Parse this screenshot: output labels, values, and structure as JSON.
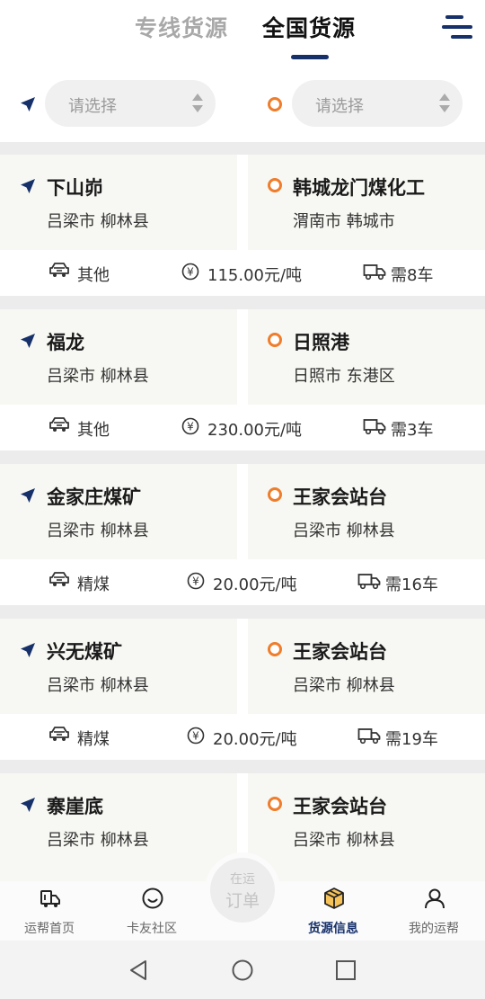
{
  "header": {
    "tabs": [
      {
        "label": "专线货源",
        "active": false
      },
      {
        "label": "全国货源",
        "active": true
      }
    ],
    "accent_color": "#16306a"
  },
  "filters": {
    "origin_placeholder": "请选择",
    "destination_placeholder": "请选择"
  },
  "cards": [
    {
      "origin_name": "下山峁",
      "origin_area": "吕梁市 柳林县",
      "dest_name": "韩城龙门煤化工",
      "dest_area": "渭南市 韩城市",
      "cargo": "其他",
      "price": "115.00元/吨",
      "trucks": "需8车"
    },
    {
      "origin_name": "福龙",
      "origin_area": "吕梁市 柳林县",
      "dest_name": "日照港",
      "dest_area": "日照市 东港区",
      "cargo": "其他",
      "price": "230.00元/吨",
      "trucks": "需3车"
    },
    {
      "origin_name": "金家庄煤矿",
      "origin_area": "吕梁市 柳林县",
      "dest_name": "王家会站台",
      "dest_area": "吕梁市 柳林县",
      "cargo": "精煤",
      "price": "20.00元/吨",
      "trucks": "需16车"
    },
    {
      "origin_name": "兴无煤矿",
      "origin_area": "吕梁市 柳林县",
      "dest_name": "王家会站台",
      "dest_area": "吕梁市 柳林县",
      "cargo": "精煤",
      "price": "20.00元/吨",
      "trucks": "需19车"
    },
    {
      "origin_name": "寨崖底",
      "origin_area": "吕梁市 柳林县",
      "dest_name": "王家会站台",
      "dest_area": "吕梁市 柳林县"
    }
  ],
  "bottom_nav": {
    "items": [
      {
        "label": "运帮首页",
        "icon": "truck-icon"
      },
      {
        "label": "卡友社区",
        "icon": "smile-icon"
      },
      {
        "label": "货源信息",
        "icon": "package-icon",
        "active": true
      },
      {
        "label": "我的运帮",
        "icon": "person-icon"
      }
    ],
    "center_button": {
      "line1": "在运",
      "line2": "订单"
    }
  },
  "colors": {
    "origin_icon": "#16306a",
    "destination_icon": "#ef7d2b",
    "package_icon": "#f0a030"
  }
}
